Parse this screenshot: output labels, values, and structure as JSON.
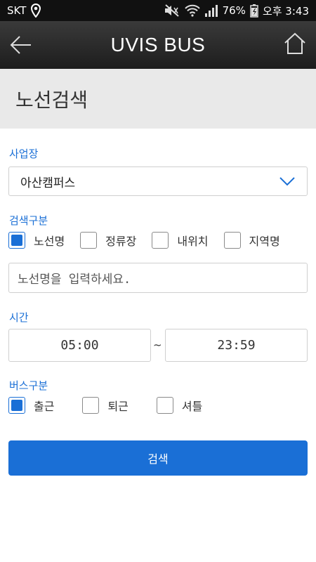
{
  "status_bar": {
    "carrier": "SKT",
    "battery": "76%",
    "time": "오후 3:43",
    "icons": [
      "location-icon",
      "mute-icon",
      "wifi-icon",
      "signal-icon",
      "battery-charging-icon"
    ]
  },
  "app_bar": {
    "title": "UVIS BUS",
    "back_icon": "back-arrow-icon",
    "home_icon": "home-icon"
  },
  "page": {
    "title": "노선검색"
  },
  "form": {
    "business_label": "사업장",
    "business_value": "아산캠퍼스",
    "search_type_label": "검색구분",
    "search_types": [
      {
        "label": "노선명",
        "checked": true
      },
      {
        "label": "정류장",
        "checked": false
      },
      {
        "label": "내위치",
        "checked": false
      },
      {
        "label": "지역명",
        "checked": false
      }
    ],
    "route_input_placeholder": "노선명을 입력하세요.",
    "time_label": "시간",
    "time_start": "05:00",
    "time_separator": "~",
    "time_end": "23:59",
    "bus_type_label": "버스구분",
    "bus_types": [
      {
        "label": "출근",
        "checked": true
      },
      {
        "label": "퇴근",
        "checked": false
      },
      {
        "label": "셔틀",
        "checked": false
      }
    ],
    "search_button": "검색"
  },
  "colors": {
    "accent": "#1a6fd6",
    "header_bg": "#e9e9e9",
    "appbar_bg": "#2a2a2a"
  }
}
